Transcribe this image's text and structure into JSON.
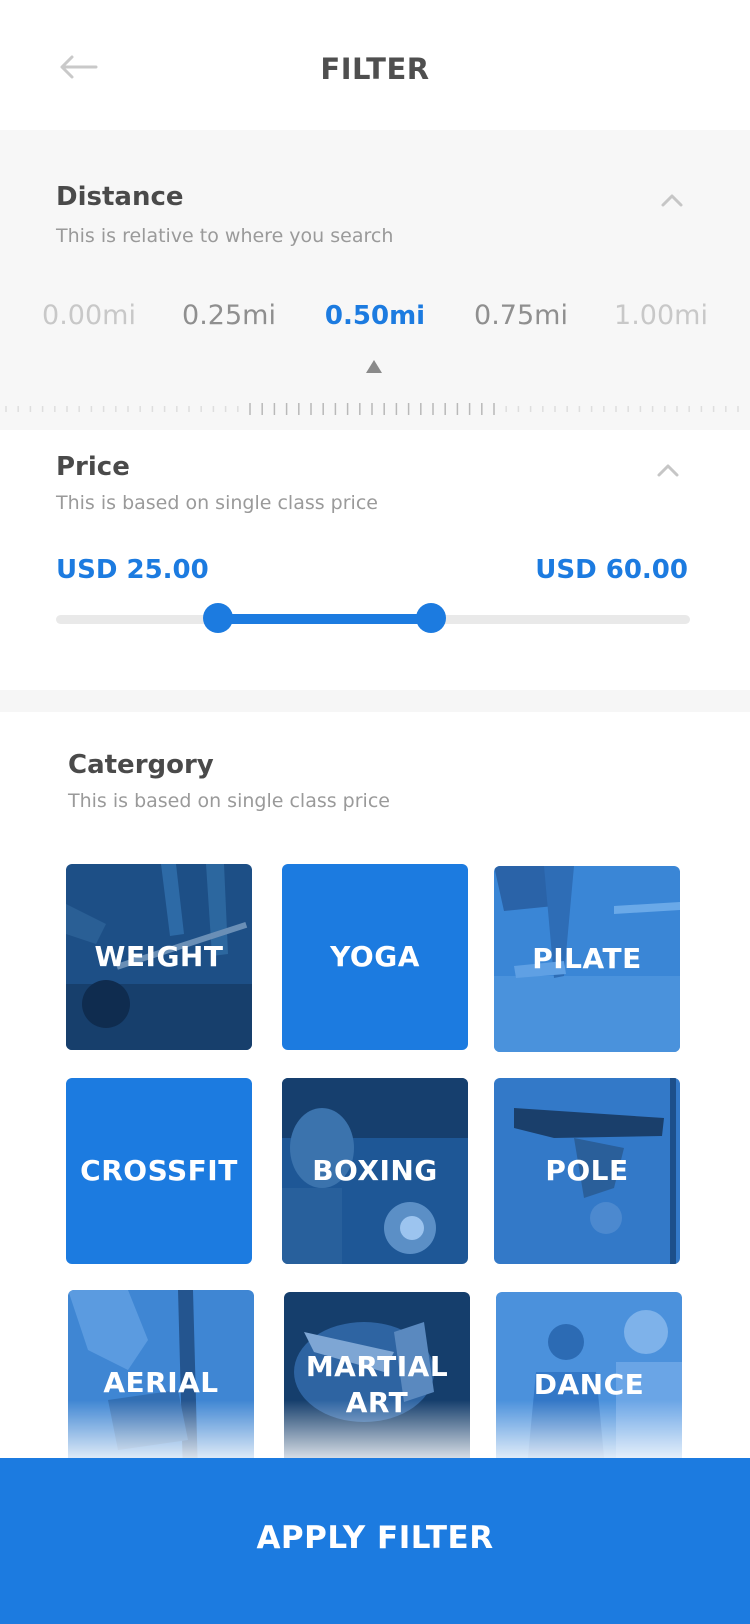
{
  "header": {
    "title": "FILTER"
  },
  "distance": {
    "title": "Distance",
    "subtitle": "This is relative to where you search",
    "options": [
      "0.00mi",
      "0.25mi",
      "0.50mi",
      "0.75mi",
      "1.00mi"
    ],
    "selected": "0.50mi"
  },
  "price": {
    "title": "Price",
    "subtitle": "This is based on single class price",
    "min_label": "USD 25.00",
    "max_label": "USD 60.00",
    "range_fraction": [
      0.25,
      0.6
    ]
  },
  "category": {
    "title": "Catergory",
    "subtitle": "This is based on single class price",
    "items": [
      {
        "label": "WEIGHT",
        "selected": false
      },
      {
        "label": "YOGA",
        "selected": true
      },
      {
        "label": "PILATE",
        "selected": false
      },
      {
        "label": "CROSSFIT",
        "selected": true
      },
      {
        "label": "BOXING",
        "selected": false
      },
      {
        "label": "POLE",
        "selected": false
      },
      {
        "label": "AERIAL",
        "selected": false
      },
      {
        "label": "MARTIAL ART",
        "selected": false
      },
      {
        "label": "DANCE",
        "selected": false
      }
    ]
  },
  "apply_button": {
    "label": "APPLY FILTER"
  },
  "colors": {
    "accent": "#1c7be0",
    "text": "#4a4a4a",
    "muted": "#9a9a9a"
  },
  "icons": {
    "back": "back-arrow-icon",
    "collapse": "chevron-up-icon",
    "pointer": "triangle-up-icon"
  }
}
